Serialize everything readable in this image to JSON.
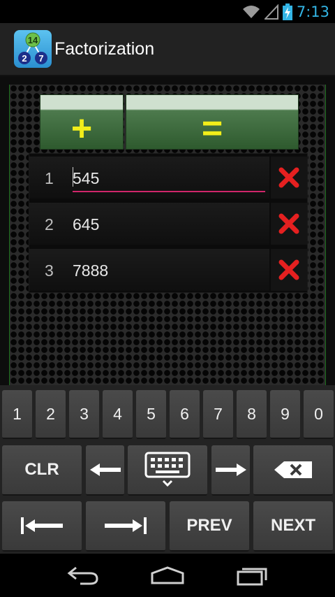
{
  "status_bar": {
    "time": "7:13",
    "icons": [
      "wifi-icon",
      "signal-icon",
      "battery-charging-icon"
    ]
  },
  "action_bar": {
    "title": "Factorization",
    "app_icon_numbers": {
      "top": "14",
      "left": "2",
      "right": "7"
    }
  },
  "buttons": {
    "add_label": "+",
    "equals_label": "="
  },
  "entries": [
    {
      "index": "1",
      "value": "545",
      "active": true
    },
    {
      "index": "2",
      "value": "645",
      "active": false
    },
    {
      "index": "3",
      "value": "7888",
      "active": false
    }
  ],
  "keyboard": {
    "digits": [
      "1",
      "2",
      "3",
      "4",
      "5",
      "6",
      "7",
      "8",
      "9",
      "0"
    ],
    "clear_label": "CLR",
    "prev_label": "PREV",
    "next_label": "NEXT"
  },
  "nav_bar": {
    "icons": [
      "back-icon",
      "home-icon",
      "recent-apps-icon"
    ]
  },
  "colors": {
    "accent_yellow": "#f2ee1a",
    "delete_red": "#e52020",
    "underline_pink": "#d0266a",
    "clock_blue": "#33b5e5"
  }
}
